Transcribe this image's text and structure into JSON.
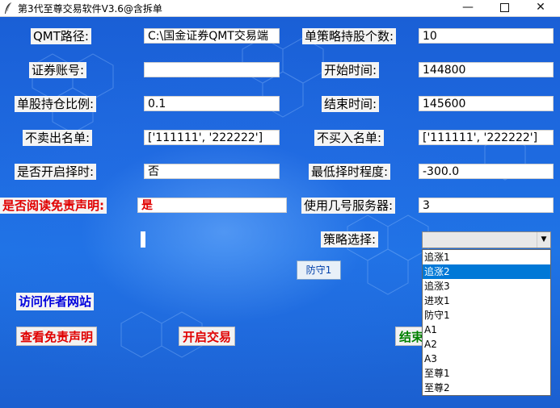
{
  "window": {
    "title": "第3代至尊交易软件V3.6@含拆单"
  },
  "form": {
    "qmt_path_label": "QMT路径:",
    "qmt_path_value": "C:\\国金证券QMT交易端",
    "max_stocks_label": "单策略持股个数:",
    "max_stocks_value": "10",
    "account_label": "证券账号:",
    "account_value": "",
    "start_time_label": "开始时间:",
    "start_time_value": "144800",
    "position_ratio_label": "单股持仓比例:",
    "position_ratio_value": "0.1",
    "end_time_label": "结束时间:",
    "end_time_value": "145600",
    "no_sell_label": "不卖出名单:",
    "no_sell_value": "['111111', '222222']",
    "no_buy_label": "不买入名单:",
    "no_buy_value": "['111111', '222222']",
    "timing_label": "是否开启择时:",
    "timing_value": "否",
    "min_timing_label": "最低择时程度:",
    "min_timing_value": "-300.0",
    "disclaimer_read_label": "是否阅读免责声明:",
    "disclaimer_read_value": "是",
    "server_label": "使用几号服务器:",
    "server_value": "3",
    "strategy_label": "策略选择:",
    "strategy_selected": ""
  },
  "strategy_button": "防守1",
  "actions": {
    "visit_site": "访问作者网站",
    "view_disclaimer": "查看免责声明",
    "start_trading": "开启交易",
    "end_trading": "结束"
  },
  "dropdown_options": [
    "追涨1",
    "追涨2",
    "追涨3",
    "进攻1",
    "防守1",
    "A1",
    "A2",
    "A3",
    "至尊1",
    "至尊2"
  ],
  "dropdown_highlighted_index": 1
}
